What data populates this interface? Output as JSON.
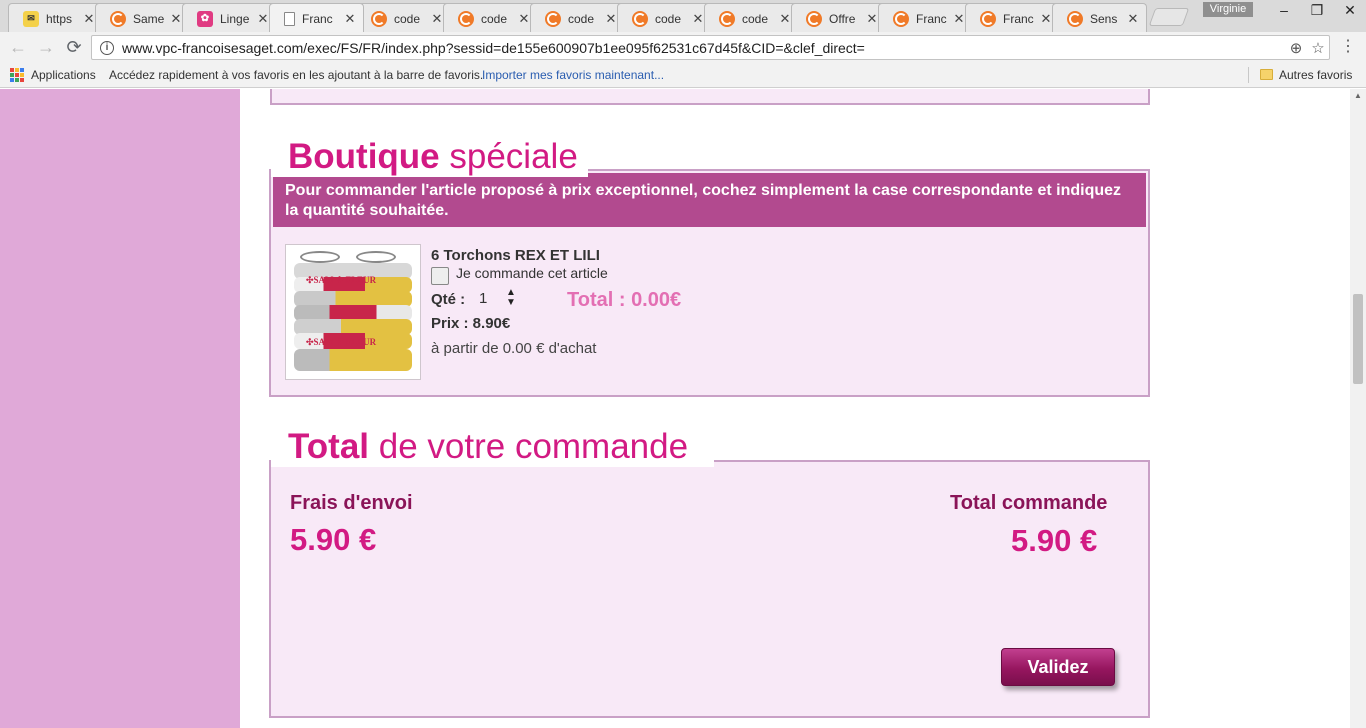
{
  "browser": {
    "tabs": [
      {
        "title": "https",
        "favicon": "post-icon"
      },
      {
        "title": "Same",
        "favicon": "c-icon"
      },
      {
        "title": "Linge",
        "favicon": "flower-icon"
      },
      {
        "title": "Franc",
        "favicon": "document-icon",
        "active": true
      },
      {
        "title": "code",
        "favicon": "c-icon"
      },
      {
        "title": "code",
        "favicon": "c-icon"
      },
      {
        "title": "code",
        "favicon": "c-icon"
      },
      {
        "title": "code",
        "favicon": "c-icon"
      },
      {
        "title": "code",
        "favicon": "c-icon"
      },
      {
        "title": "Offre",
        "favicon": "c-icon"
      },
      {
        "title": "Franc",
        "favicon": "c-icon"
      },
      {
        "title": "Franc",
        "favicon": "c-icon"
      },
      {
        "title": "Sens",
        "favicon": "c-icon"
      }
    ],
    "profile_name": "Virginie",
    "url": "www.vpc-francoisesaget.com/exec/FS/FR/index.php?sessid=de155e600907b1ee095f62531c67d45f&CID=&clef_direct=",
    "bookmarks": {
      "apps_label": "Applications",
      "hint": "Accédez rapidement à vos favoris en les ajoutant à la barre de favoris.",
      "import_link": "Importer mes favoris maintenant...",
      "other_label": "Autres favoris"
    }
  },
  "page": {
    "special_shop": {
      "title_bold": "Boutique",
      "title_light": "spéciale",
      "banner": "Pour commander l'article proposé à prix exceptionnel, cochez simplement la case correspondante et indiquez la quantité souhaitée.",
      "product": {
        "name": "6 Torchons REX ET LILI",
        "checkbox_label": "Je commande cet article",
        "checked": false,
        "qty_label": "Qté :",
        "qty_value": "1",
        "price_label": "Prix : 8.90€",
        "threshold": "à partir de 0.00 € d'achat",
        "line_total": "Total : 0.00€"
      }
    },
    "order_total": {
      "title_bold": "Total",
      "title_light": "de votre commande",
      "shipping_label": "Frais d'envoi",
      "shipping_value": "5.90 €",
      "total_label": "Total commande",
      "total_value": "5.90 €",
      "validate_label": "Validez"
    }
  },
  "colors": {
    "accent": "#d21a83",
    "banner": "#b24a8f",
    "sidebar": "#e0a9d8",
    "panel": "#f8e9f7",
    "border": "#c9a0c6"
  }
}
